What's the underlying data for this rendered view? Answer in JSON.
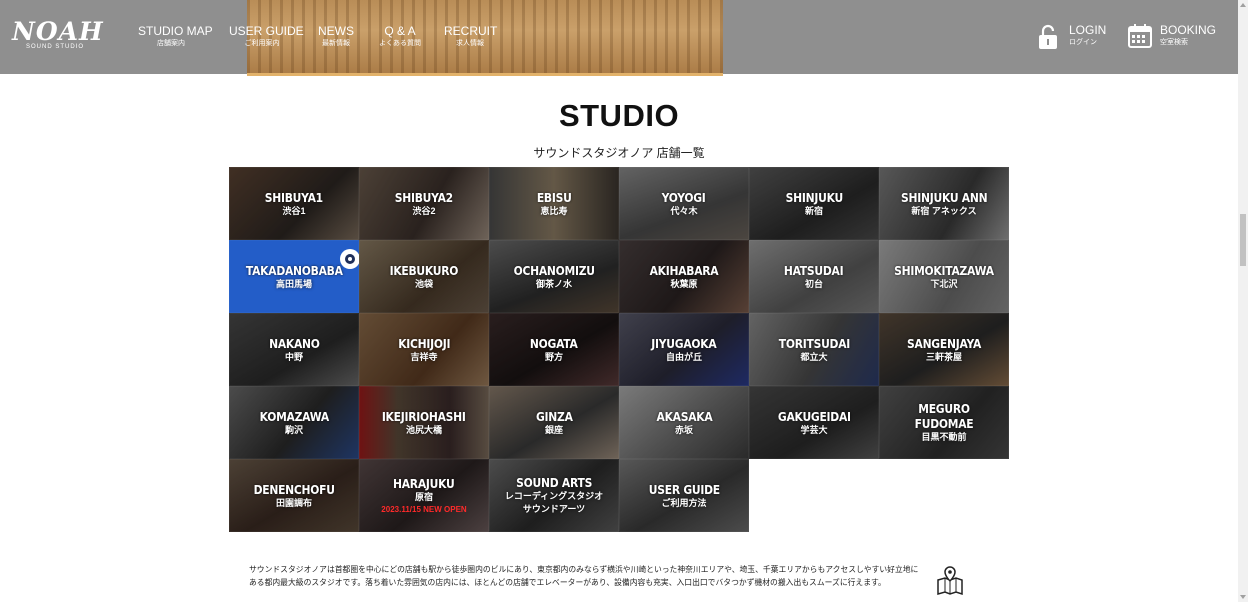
{
  "header": {
    "logo_word": "NOAH",
    "logo_sub": "SOUND STUDIO",
    "nav": [
      {
        "en": "STUDIO MAP",
        "jp": "店舗案内"
      },
      {
        "en": "USER GUIDE",
        "jp": "ご利用案内"
      },
      {
        "en": "NEWS",
        "jp": "最新情報"
      },
      {
        "en": "Q & A",
        "jp": "よくある質問"
      },
      {
        "en": "RECRUIT",
        "jp": "求人情報"
      }
    ],
    "login": {
      "en": "LOGIN",
      "jp": "ログイン",
      "icon": "lock-icon"
    },
    "booking": {
      "en": "BOOKING",
      "jp": "空室検索",
      "icon": "calendar-icon"
    }
  },
  "section": {
    "title": "STUDIO",
    "subtitle": "サウンドスタジオノア 店舗一覧"
  },
  "studios": [
    {
      "name": "SHIBUYA1",
      "jp": "渋谷1"
    },
    {
      "name": "SHIBUYA2",
      "jp": "渋谷2"
    },
    {
      "name": "EBISU",
      "jp": "恵比寿"
    },
    {
      "name": "YOYOGI",
      "jp": "代々木"
    },
    {
      "name": "SHINJUKU",
      "jp": "新宿"
    },
    {
      "name": "SHINJUKU ANN",
      "jp": "新宿 アネックス"
    },
    {
      "name": "TAKADANOBABA",
      "jp": "高田馬場"
    },
    {
      "name": "IKEBUKURO",
      "jp": "池袋"
    },
    {
      "name": "OCHANOMIZU",
      "jp": "御茶ノ水"
    },
    {
      "name": "AKIHABARA",
      "jp": "秋葉原"
    },
    {
      "name": "HATSUDAI",
      "jp": "初台"
    },
    {
      "name": "SHIMOKITAZAWA",
      "jp": "下北沢"
    },
    {
      "name": "NAKANO",
      "jp": "中野"
    },
    {
      "name": "KICHIJOJI",
      "jp": "吉祥寺"
    },
    {
      "name": "NOGATA",
      "jp": "野方"
    },
    {
      "name": "JIYUGAOKA",
      "jp": "自由が丘"
    },
    {
      "name": "TORITSUDAI",
      "jp": "都立大"
    },
    {
      "name": "SANGENJAYA",
      "jp": "三軒茶屋"
    },
    {
      "name": "KOMAZAWA",
      "jp": "駒沢"
    },
    {
      "name": "IKEJIRIOHASHI",
      "jp": "池尻大橋"
    },
    {
      "name": "GINZA",
      "jp": "銀座"
    },
    {
      "name": "AKASAKA",
      "jp": "赤坂"
    },
    {
      "name": "GAKUGEIDAI",
      "jp": "学芸大"
    },
    {
      "name": "MEGURO FUDOMAE",
      "jp": "目黒不動前"
    },
    {
      "name": "DENENCHOFU",
      "jp": "田園調布"
    },
    {
      "name": "HARAJUKU",
      "jp": "原宿",
      "note": "2023.11/15 NEW OPEN"
    },
    {
      "name": "SOUND ARTS",
      "jp": "レコーディングスタジオ",
      "jp2": "サウンドアーツ"
    },
    {
      "name": "USER GUIDE",
      "jp": "ご利用方法"
    }
  ],
  "description": "サウンドスタジオノアは首都圏を中心にどの店舗も駅から徒歩圏内のビルにあり、東京都内のみならず横浜や川崎といった神奈川エリアや、埼玉、千葉エリアからもアクセスしやすい好立地にある都内最大級のスタジオです。落ち着いた雰囲気の店内には、ほとんどの店舗でエレベーターがあり、設備内容も充実、入口出口でバタつかず機材の搬入出もスムーズに行えます。"
}
